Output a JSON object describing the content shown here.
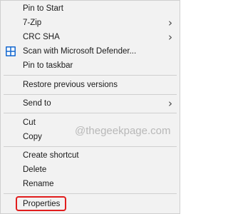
{
  "context_menu": {
    "items": [
      {
        "label": "Pin to Start"
      },
      {
        "label": "7-Zip",
        "submenu_arrow": "›"
      },
      {
        "label": "CRC SHA",
        "submenu_arrow": "›"
      },
      {
        "label": "Scan with Microsoft Defender...",
        "icon": "windows-defender-icon"
      },
      {
        "label": "Pin to taskbar"
      },
      {
        "label": "Restore previous versions"
      },
      {
        "label": "Send to",
        "submenu_arrow": "›"
      },
      {
        "label": "Cut"
      },
      {
        "label": "Copy"
      },
      {
        "label": "Create shortcut"
      },
      {
        "label": "Delete"
      },
      {
        "label": "Rename"
      },
      {
        "label": "Properties"
      }
    ]
  },
  "watermark": "@thegeekpage.com",
  "colors": {
    "menu_background": "#f2f2f2",
    "separator": "#cfcfcf",
    "highlight_outline": "#e11d1d",
    "defender_blue": "#1f6fd1"
  }
}
